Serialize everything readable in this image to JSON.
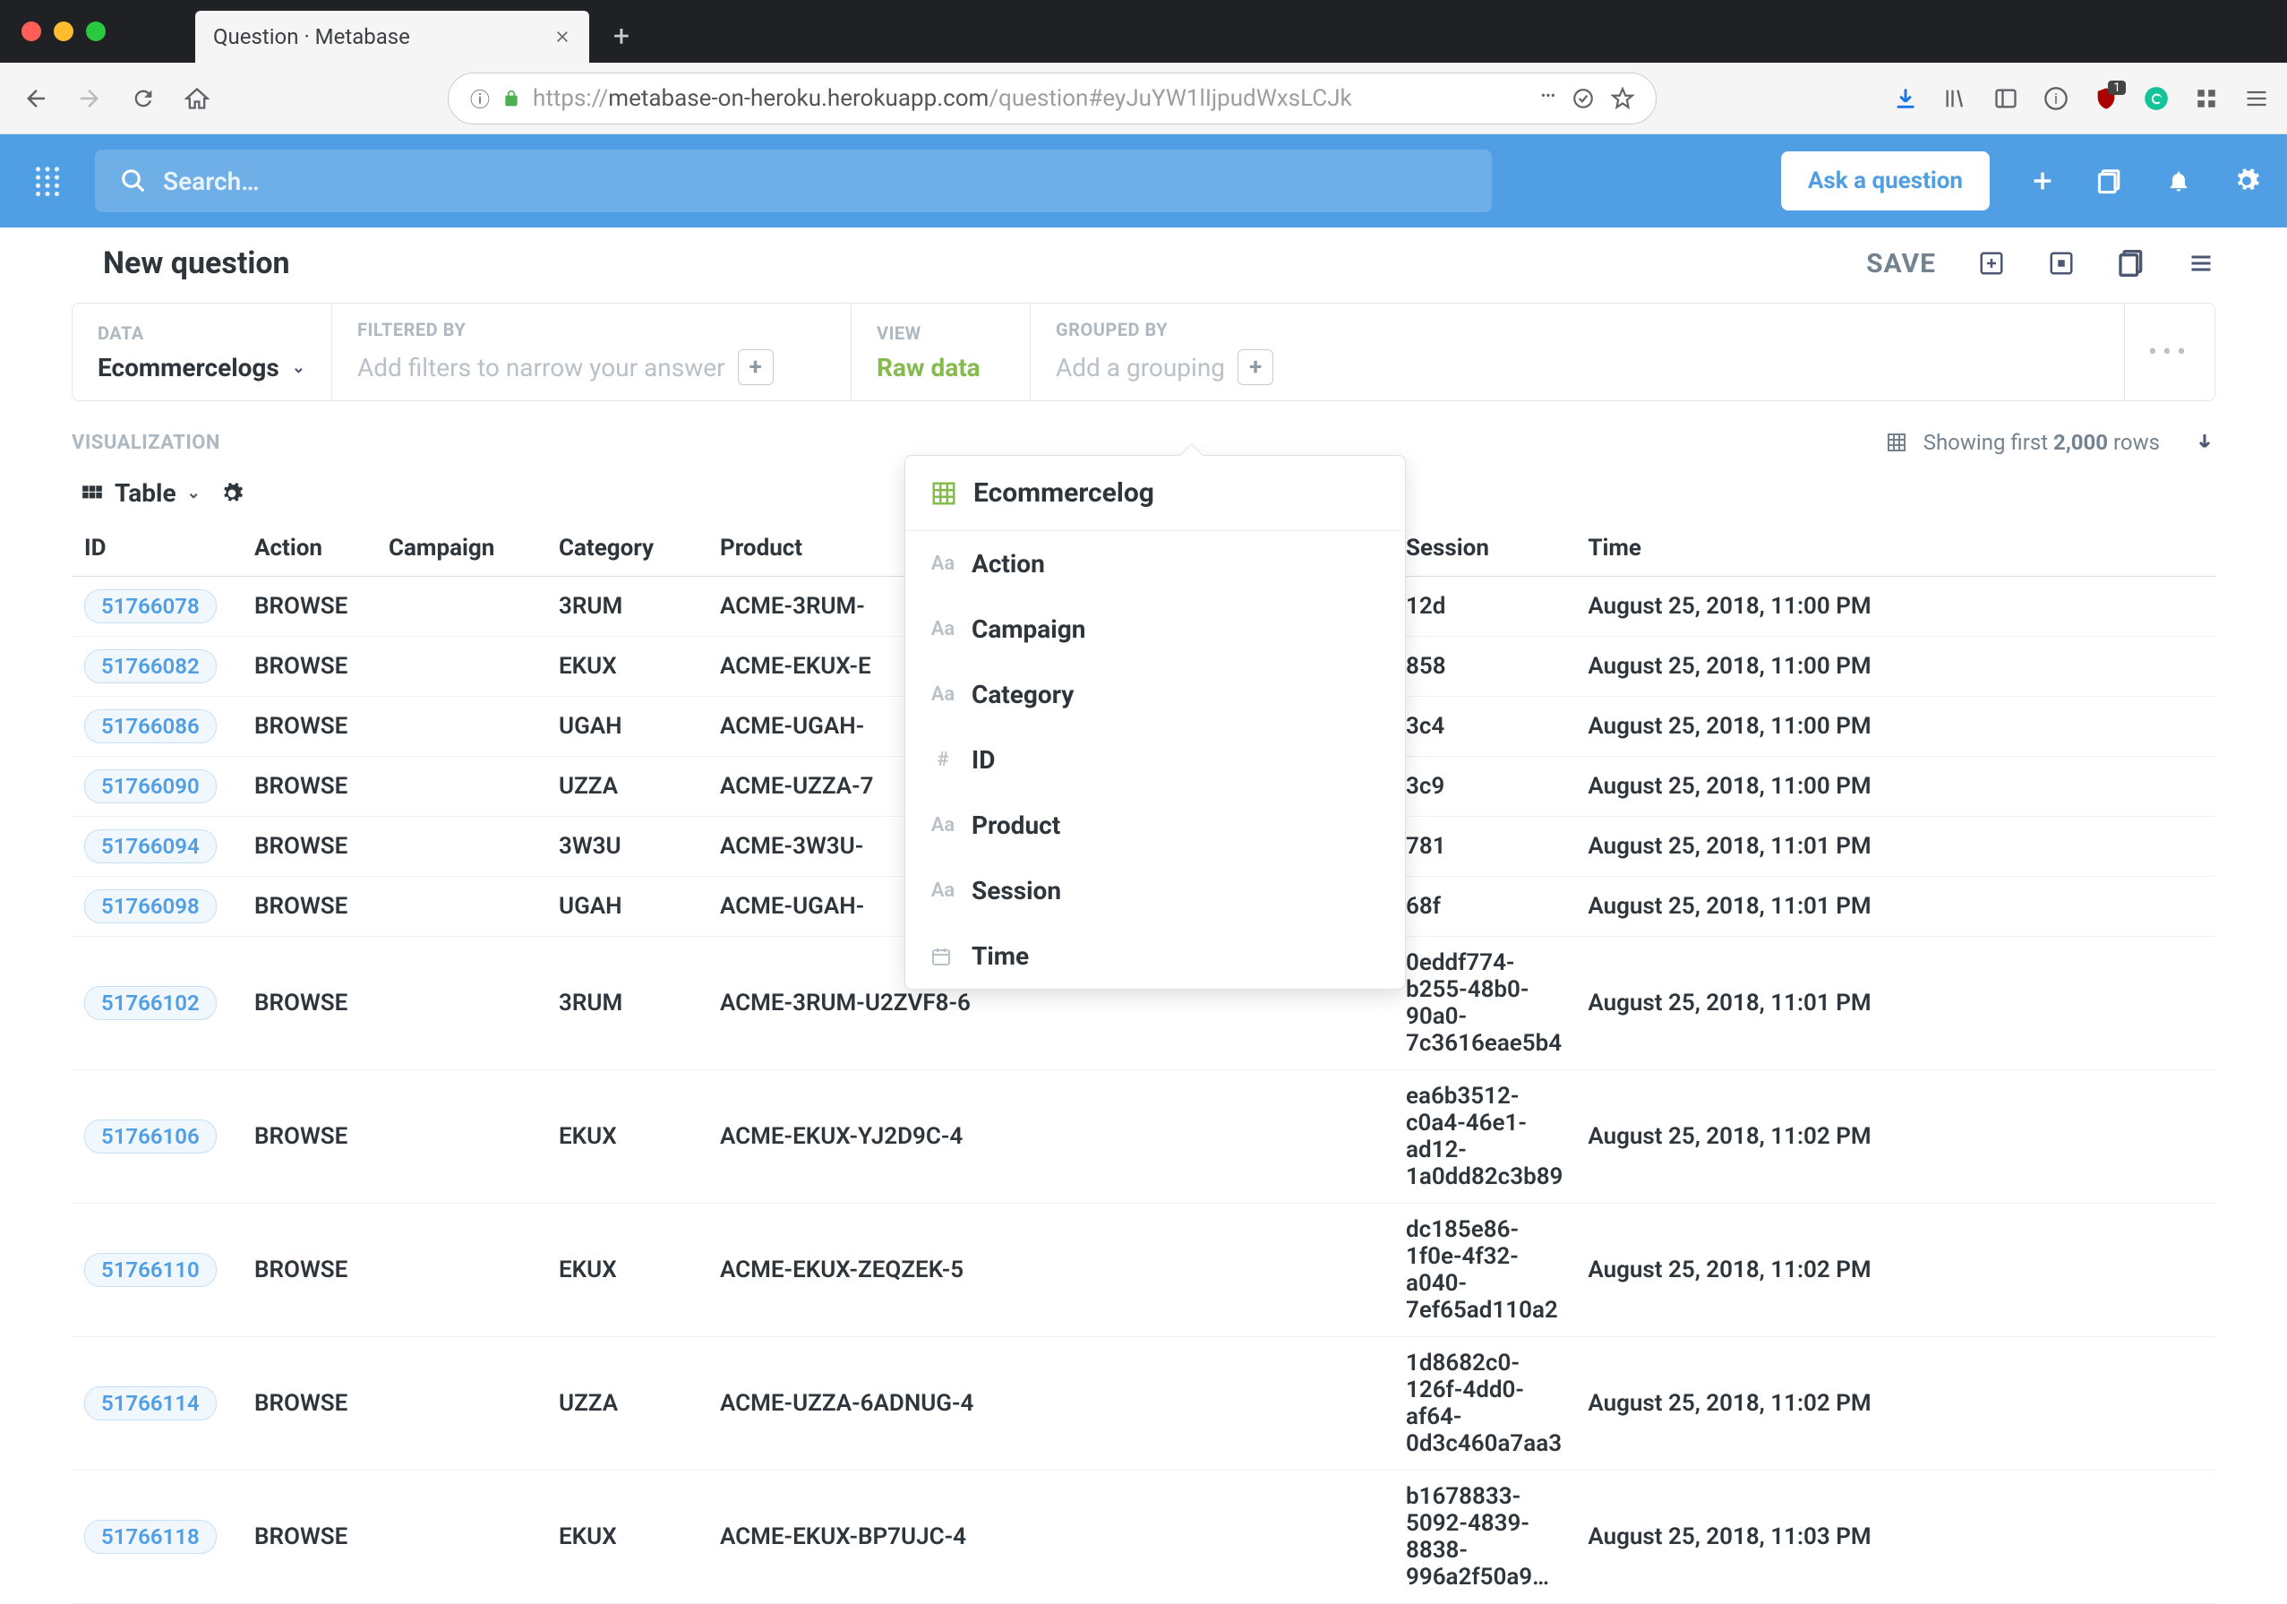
{
  "browser": {
    "tab_title": "Question · Metabase",
    "url_prefix": "https://",
    "url_domain": "metabase-on-heroku.herokuapp.com",
    "url_path": "/question#eyJuYW1lIjpudWxsLCJk",
    "badge_count": "1"
  },
  "header": {
    "search_placeholder": "Search…",
    "ask_button": "Ask a question"
  },
  "question": {
    "title": "New question",
    "save_label": "SAVE"
  },
  "query_builder": {
    "data_label": "DATA",
    "data_value": "Ecommercelogs",
    "filter_label": "FILTERED BY",
    "filter_placeholder": "Add filters to narrow your answer",
    "view_label": "VIEW",
    "view_value": "Raw data",
    "group_label": "GROUPED BY",
    "group_placeholder": "Add a grouping"
  },
  "visualization": {
    "section_label": "VISUALIZATION",
    "type": "Table",
    "showing_prefix": "Showing first ",
    "showing_count": "2,000",
    "showing_suffix": " rows"
  },
  "popover": {
    "title": "Ecommercelog",
    "items": [
      {
        "icon": "Aa",
        "label": "Action"
      },
      {
        "icon": "Aa",
        "label": "Campaign"
      },
      {
        "icon": "Aa",
        "label": "Category"
      },
      {
        "icon": "#",
        "label": "ID"
      },
      {
        "icon": "Aa",
        "label": "Product"
      },
      {
        "icon": "Aa",
        "label": "Session"
      },
      {
        "icon": "cal",
        "label": "Time"
      }
    ]
  },
  "table": {
    "columns": [
      "ID",
      "Action",
      "Campaign",
      "Category",
      "Product",
      "Session",
      "Time"
    ],
    "rows": [
      {
        "id": "51766078",
        "action": "BROWSE",
        "campaign": "",
        "category": "3RUM",
        "product": "ACME-3RUM-",
        "session": "12d",
        "time": "August 25, 2018, 11:00 PM"
      },
      {
        "id": "51766082",
        "action": "BROWSE",
        "campaign": "",
        "category": "EKUX",
        "product": "ACME-EKUX-E",
        "session": "858",
        "time": "August 25, 2018, 11:00 PM"
      },
      {
        "id": "51766086",
        "action": "BROWSE",
        "campaign": "",
        "category": "UGAH",
        "product": "ACME-UGAH-",
        "session": "3c4",
        "time": "August 25, 2018, 11:00 PM"
      },
      {
        "id": "51766090",
        "action": "BROWSE",
        "campaign": "",
        "category": "UZZA",
        "product": "ACME-UZZA-7",
        "session": "3c9",
        "time": "August 25, 2018, 11:00 PM"
      },
      {
        "id": "51766094",
        "action": "BROWSE",
        "campaign": "",
        "category": "3W3U",
        "product": "ACME-3W3U-",
        "session": "781",
        "time": "August 25, 2018, 11:01 PM"
      },
      {
        "id": "51766098",
        "action": "BROWSE",
        "campaign": "",
        "category": "UGAH",
        "product": "ACME-UGAH-",
        "session": "68f",
        "time": "August 25, 2018, 11:01 PM"
      },
      {
        "id": "51766102",
        "action": "BROWSE",
        "campaign": "",
        "category": "3RUM",
        "product": "ACME-3RUM-U2ZVF8-6",
        "session": "0eddf774-b255-48b0-90a0-7c3616eae5b4",
        "time": "August 25, 2018, 11:01 PM"
      },
      {
        "id": "51766106",
        "action": "BROWSE",
        "campaign": "",
        "category": "EKUX",
        "product": "ACME-EKUX-YJ2D9C-4",
        "session": "ea6b3512-c0a4-46e1-ad12-1a0dd82c3b89",
        "time": "August 25, 2018, 11:02 PM"
      },
      {
        "id": "51766110",
        "action": "BROWSE",
        "campaign": "",
        "category": "EKUX",
        "product": "ACME-EKUX-ZEQZEK-5",
        "session": "dc185e86-1f0e-4f32-a040-7ef65ad110a2",
        "time": "August 25, 2018, 11:02 PM"
      },
      {
        "id": "51766114",
        "action": "BROWSE",
        "campaign": "",
        "category": "UZZA",
        "product": "ACME-UZZA-6ADNUG-4",
        "session": "1d8682c0-126f-4dd0-af64-0d3c460a7aa3",
        "time": "August 25, 2018, 11:02 PM"
      },
      {
        "id": "51766118",
        "action": "BROWSE",
        "campaign": "",
        "category": "EKUX",
        "product": "ACME-EKUX-BP7UJC-4",
        "session": "b1678833-5092-4839-8838-996a2f50a9…",
        "time": "August 25, 2018, 11:03 PM"
      }
    ]
  }
}
